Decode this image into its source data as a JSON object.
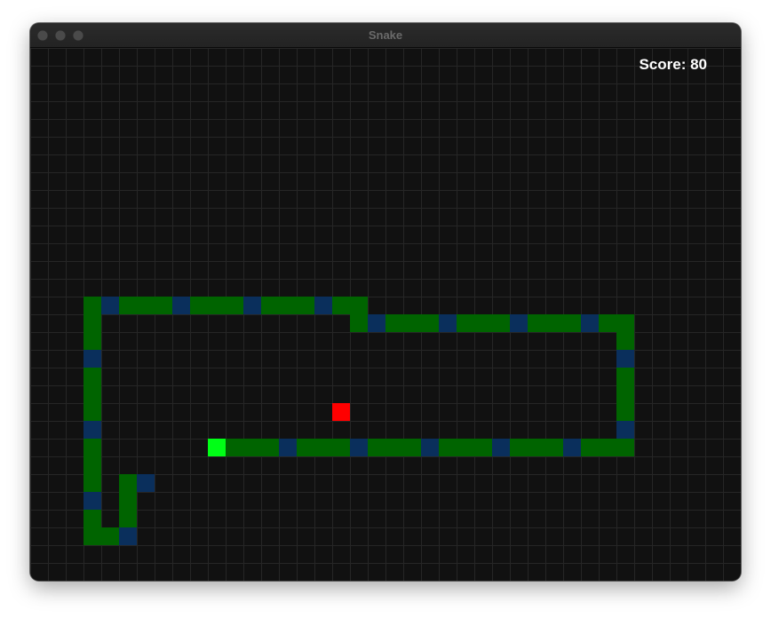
{
  "window": {
    "title": "Snake"
  },
  "score": {
    "label": "Score: 80"
  },
  "colors": {
    "background": "#111111",
    "grid_line": "#262626",
    "snake_body": "#006400",
    "snake_joint": "#0a2f5c",
    "snake_head": "#00ff16",
    "food": "#ff0000",
    "score_text": "#ffffff"
  },
  "grid": {
    "cols": 40,
    "rows": 30
  },
  "food": [
    17,
    20
  ],
  "snake": {
    "head": [
      10,
      22
    ],
    "body": [
      [
        11,
        22
      ],
      [
        12,
        22
      ],
      [
        13,
        22
      ],
      [
        14,
        22
      ],
      [
        15,
        22
      ],
      [
        16,
        22
      ],
      [
        17,
        22
      ],
      [
        18,
        22
      ],
      [
        19,
        22
      ],
      [
        20,
        22
      ],
      [
        21,
        22
      ],
      [
        22,
        22
      ],
      [
        23,
        22
      ],
      [
        24,
        22
      ],
      [
        25,
        22
      ],
      [
        26,
        22
      ],
      [
        27,
        22
      ],
      [
        28,
        22
      ],
      [
        29,
        22
      ],
      [
        30,
        22
      ],
      [
        31,
        22
      ],
      [
        32,
        22
      ],
      [
        33,
        22
      ],
      [
        33,
        21
      ],
      [
        33,
        20
      ],
      [
        33,
        19
      ],
      [
        33,
        18
      ],
      [
        33,
        17
      ],
      [
        33,
        16
      ],
      [
        33,
        15
      ],
      [
        32,
        15
      ],
      [
        31,
        15
      ],
      [
        30,
        15
      ],
      [
        29,
        15
      ],
      [
        28,
        15
      ],
      [
        27,
        15
      ],
      [
        26,
        15
      ],
      [
        25,
        15
      ],
      [
        24,
        15
      ],
      [
        23,
        15
      ],
      [
        22,
        15
      ],
      [
        21,
        15
      ],
      [
        20,
        15
      ],
      [
        19,
        15
      ],
      [
        18,
        15
      ],
      [
        18,
        14
      ],
      [
        17,
        14
      ],
      [
        16,
        14
      ],
      [
        15,
        14
      ],
      [
        14,
        14
      ],
      [
        13,
        14
      ],
      [
        12,
        14
      ],
      [
        11,
        14
      ],
      [
        10,
        14
      ],
      [
        9,
        14
      ],
      [
        8,
        14
      ],
      [
        7,
        14
      ],
      [
        6,
        14
      ],
      [
        5,
        14
      ],
      [
        4,
        14
      ],
      [
        3,
        14
      ],
      [
        3,
        15
      ],
      [
        3,
        16
      ],
      [
        3,
        17
      ],
      [
        3,
        18
      ],
      [
        3,
        19
      ],
      [
        3,
        20
      ],
      [
        3,
        21
      ],
      [
        3,
        22
      ],
      [
        3,
        23
      ],
      [
        3,
        24
      ],
      [
        3,
        25
      ],
      [
        3,
        26
      ],
      [
        3,
        27
      ],
      [
        4,
        27
      ],
      [
        5,
        27
      ],
      [
        5,
        26
      ],
      [
        5,
        25
      ],
      [
        5,
        24
      ],
      [
        6,
        24
      ]
    ],
    "joint_interval": 4
  }
}
